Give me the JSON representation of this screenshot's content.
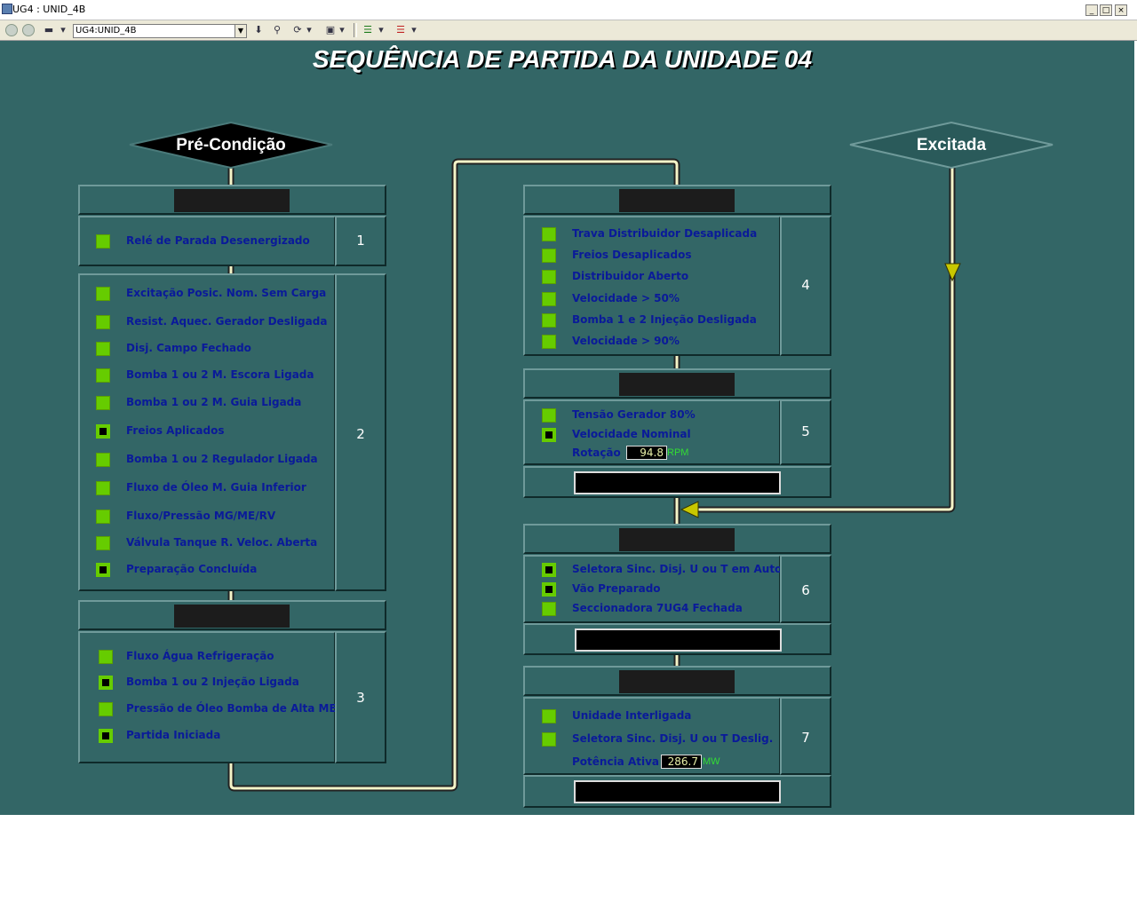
{
  "window": {
    "title": "UG4 : UNID_4B",
    "address": "UG4:UNID_4B"
  },
  "screen_title": "SEQUÊNCIA DE PARTIDA DA UNIDADE 04",
  "diamonds": {
    "precondicao": "Pré-Condição",
    "excitada": "Excitada"
  },
  "colors": {
    "background": "#336666",
    "check_green": "#66cc00",
    "label_blue": "#0a1a99",
    "pipe_yellow": "#f4f4c8",
    "arrow_yellow": "#c8c800"
  },
  "steps": {
    "s1": {
      "number": "1",
      "items": [
        {
          "label": "Relé de Parada Desenergizado",
          "state": "on"
        }
      ]
    },
    "s2": {
      "number": "2",
      "items": [
        {
          "label": "Excitação Posic. Nom. Sem Carga",
          "state": "on"
        },
        {
          "label": "Resist. Aquec. Gerador Desligada",
          "state": "on"
        },
        {
          "label": "Disj. Campo Fechado",
          "state": "on"
        },
        {
          "label": "Bomba 1 ou 2 M. Escora Ligada",
          "state": "on"
        },
        {
          "label": "Bomba 1 ou 2 M. Guia Ligada",
          "state": "on"
        },
        {
          "label": "Freios Aplicados",
          "state": "off"
        },
        {
          "label": "Bomba 1 ou 2 Regulador Ligada",
          "state": "on"
        },
        {
          "label": "Fluxo de Óleo M. Guia Inferior",
          "state": "on"
        },
        {
          "label": "Fluxo/Pressão MG/ME/RV",
          "state": "on"
        },
        {
          "label": "Válvula Tanque R. Veloc. Aberta",
          "state": "on"
        },
        {
          "label": "Preparação Concluída",
          "state": "off"
        }
      ]
    },
    "s3": {
      "number": "3",
      "items": [
        {
          "label": "Fluxo Água Refrigeração",
          "state": "on"
        },
        {
          "label": "Bomba 1 ou 2 Injeção Ligada",
          "state": "off"
        },
        {
          "label": "Pressão de Óleo Bomba de Alta ME",
          "state": "on"
        },
        {
          "label": "Partida Iniciada",
          "state": "off"
        }
      ]
    },
    "s4": {
      "number": "4",
      "items": [
        {
          "label": "Trava Distribuidor Desaplicada",
          "state": "on"
        },
        {
          "label": "Freios Desaplicados",
          "state": "on"
        },
        {
          "label": "Distribuidor Aberto",
          "state": "on"
        },
        {
          "label": "Velocidade > 50%",
          "state": "on"
        },
        {
          "label": "Bomba 1 e 2 Injeção Desligada",
          "state": "on"
        },
        {
          "label": "Velocidade > 90%",
          "state": "on"
        }
      ]
    },
    "s5": {
      "number": "5",
      "items": [
        {
          "label": "Tensão Gerador 80%",
          "state": "on"
        },
        {
          "label": "Velocidade Nominal",
          "state": "off"
        }
      ],
      "reading_label": "Rotação",
      "reading_value": "94.8",
      "reading_unit": "RPM"
    },
    "s6": {
      "number": "6",
      "items": [
        {
          "label": "Seletora Sinc. Disj. U ou T em Auto",
          "state": "off"
        },
        {
          "label": "Vão Preparado",
          "state": "off"
        },
        {
          "label": "Seccionadora 7UG4 Fechada",
          "state": "on"
        }
      ]
    },
    "s7": {
      "number": "7",
      "items": [
        {
          "label": "Unidade Interligada",
          "state": "on"
        },
        {
          "label": "Seletora Sinc. Disj. U ou T Deslig.",
          "state": "on"
        }
      ],
      "reading_label": "Potência Ativa",
      "reading_value": "286.7",
      "reading_unit": "MW"
    }
  }
}
